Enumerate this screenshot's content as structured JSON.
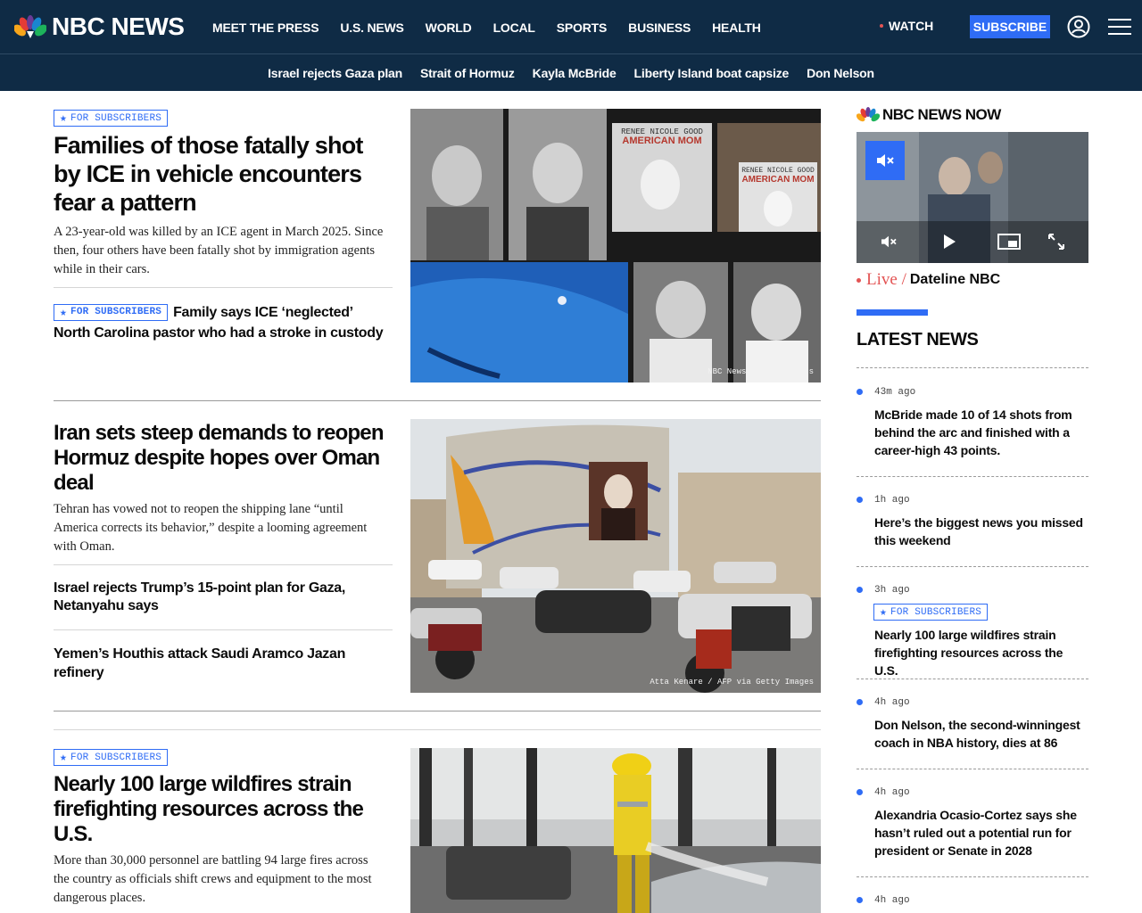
{
  "brand": {
    "name": "NBC NEWS"
  },
  "nav": {
    "items": [
      "MEET THE PRESS",
      "U.S. NEWS",
      "WORLD",
      "LOCAL",
      "SPORTS",
      "BUSINESS",
      "HEALTH"
    ],
    "watch_label": "WATCH",
    "subscribe_label": "SUBSCRIBE"
  },
  "trending": [
    "Israel rejects Gaza plan",
    "Strait of Hormuz",
    "Kayla McBride",
    "Liberty Island boat capsize",
    "Don Nelson"
  ],
  "badge_label": "FOR SUBSCRIBERS",
  "stories": {
    "s1": {
      "headline": "Families of those fatally shot by ICE in vehicle encounters fear a pattern",
      "dek": "A 23-year-old was killed by an ICE agent in March 2025. Since then, four others have been fatally shot by immigration agents while in their cars.",
      "related": "Family says ICE ‘neglected’ North Carolina pastor who had a stroke in custody",
      "credit": "NBC News; Getty Images",
      "sign_line1": "RENEE NICOLE GOOD",
      "sign_line2": "AMERICAN MOM"
    },
    "s2": {
      "headline": "Iran sets steep demands to reopen Hormuz despite hopes over Oman deal",
      "dek": "Tehran has vowed not to reopen the shipping lane “until America corrects its behavior,” despite a looming agreement with Oman.",
      "related1": "Israel rejects Trump’s 15-point plan for Gaza, Netanyahu says",
      "related2": "Yemen’s Houthis attack Saudi Aramco Jazan refinery",
      "credit": "Atta Kenare / AFP via Getty Images"
    },
    "s3": {
      "headline": "Nearly 100 large wildfires strain firefighting resources across the U.S.",
      "dek": "More than 30,000 personnel are battling 94 large fires across the country as officials shift crews and equipment to the most dangerous places."
    }
  },
  "rail": {
    "logo_text": "NBC NEWS NOW",
    "live_label": "Live /",
    "show": "Dateline NBC",
    "latest_title": "LATEST NEWS",
    "items": [
      {
        "time": "43m ago",
        "headline": "McBride made 10 of 14 shots from behind the arc and finished with a career-high 43 points."
      },
      {
        "time": "1h ago",
        "headline": "Here’s the biggest news you missed this weekend"
      },
      {
        "time": "3h ago",
        "headline": "Nearly 100 large wildfires strain firefighting resources across the U.S.",
        "badge": "FOR SUBSCRIBERS"
      },
      {
        "time": "4h ago",
        "headline": "Don Nelson, the second-winningest coach in NBA history, dies at 86"
      },
      {
        "time": "4h ago",
        "headline": "Alexandria Ocasio-Cortez says she hasn’t ruled out a potential run for president or Senate in 2028"
      },
      {
        "time": "4h ago",
        "headline": ""
      }
    ]
  },
  "colors": {
    "header_bg": "#0f2b45",
    "accent_blue": "#2f6cf5",
    "live_red": "#e35454"
  },
  "icons": [
    "peacock-logo-icon",
    "account-icon",
    "hamburger-menu-icon",
    "star-icon",
    "mute-icon",
    "play-icon",
    "picture-in-picture-icon",
    "fullscreen-icon"
  ]
}
